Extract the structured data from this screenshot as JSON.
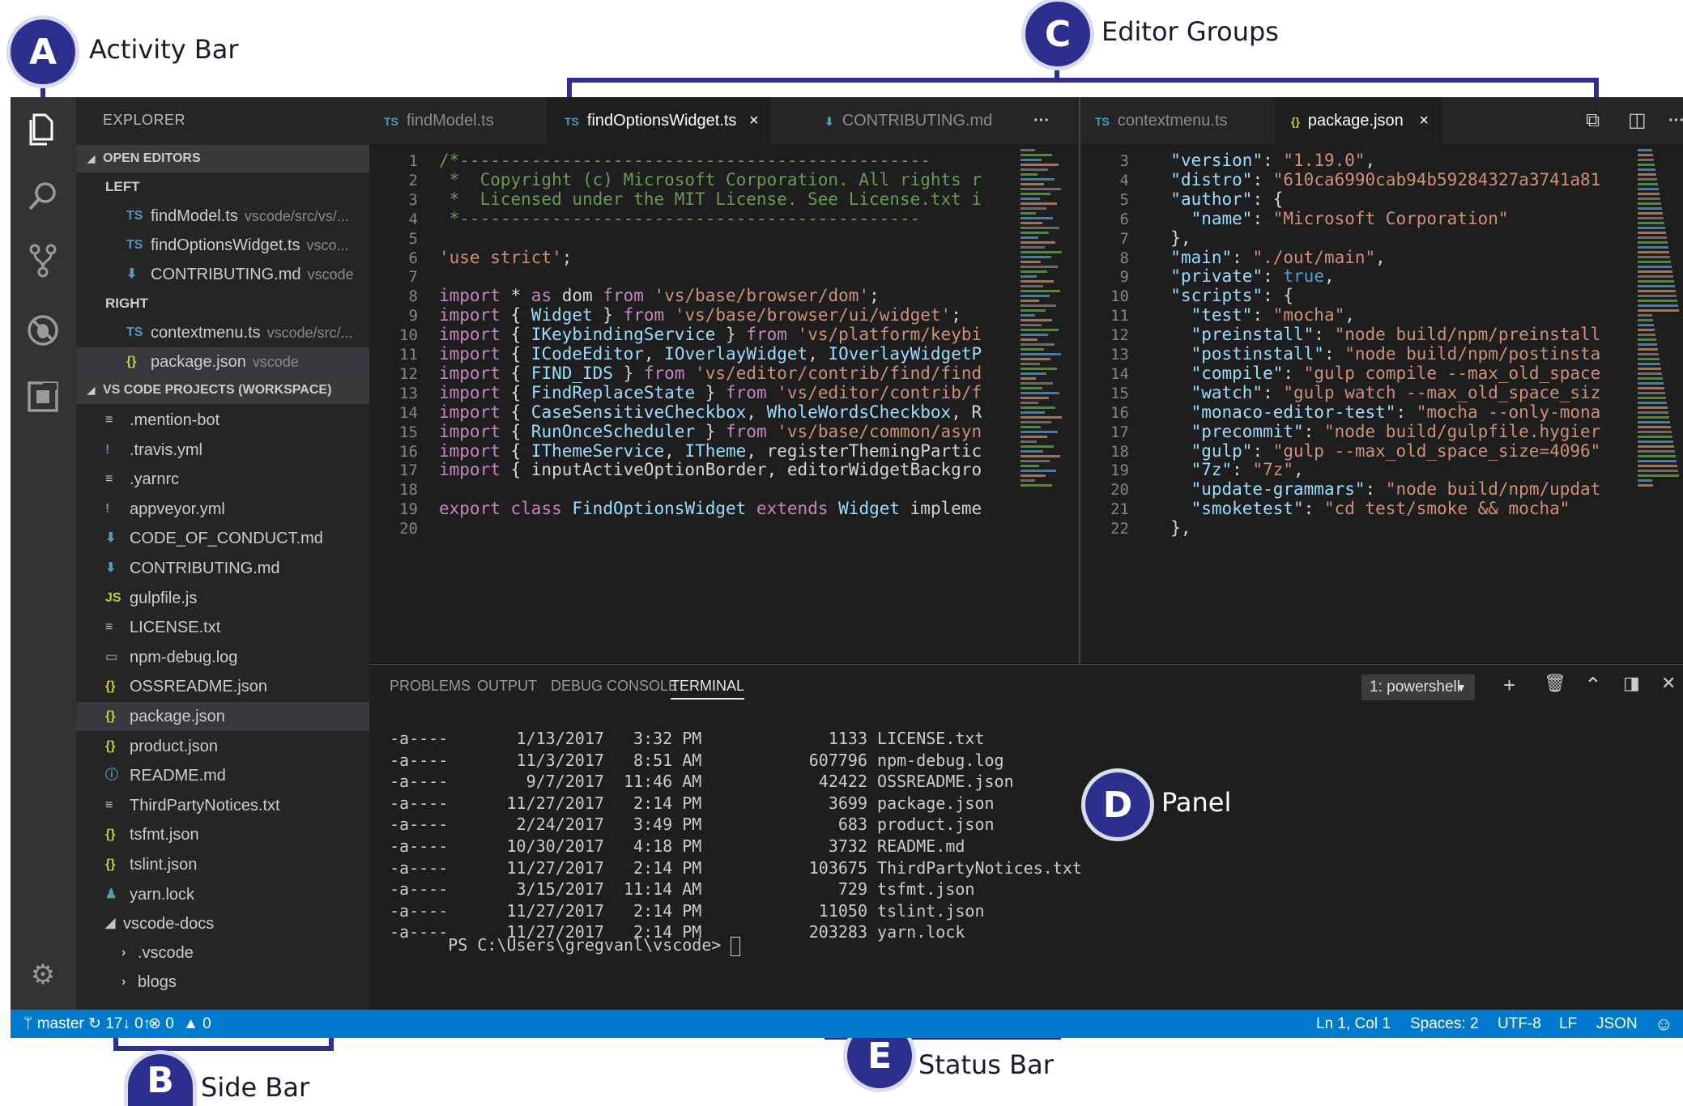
{
  "callouts": [
    {
      "letter": "A",
      "label": "Activity Bar"
    },
    {
      "letter": "B",
      "label": "Side Bar"
    },
    {
      "letter": "C",
      "label": "Editor Groups"
    },
    {
      "letter": "D",
      "label": "Panel"
    },
    {
      "letter": "E",
      "label": "Status Bar"
    }
  ],
  "activity_bar": {
    "icons": [
      "files-icon",
      "search-icon",
      "source-control-icon",
      "debug-icon",
      "extensions-icon"
    ],
    "bottom_icon": "gear-icon"
  },
  "sidebar": {
    "title": "EXPLORER",
    "open_editors_header": "OPEN EDITORS",
    "groups": [
      {
        "label": "LEFT",
        "items": [
          {
            "icon": "TS",
            "name": "findModel.ts",
            "desc": "vscode/src/vs/..."
          },
          {
            "icon": "TS",
            "name": "findOptionsWidget.ts",
            "desc": "vsco..."
          },
          {
            "icon": "⬇",
            "name": "CONTRIBUTING.md",
            "desc": "vscode"
          }
        ]
      },
      {
        "label": "RIGHT",
        "items": [
          {
            "icon": "TS",
            "name": "contextmenu.ts",
            "desc": "vscode/src/..."
          },
          {
            "icon": "{}",
            "name": "package.json",
            "desc": "vscode"
          }
        ]
      }
    ],
    "workspace_header": "VS CODE PROJECTS (WORKSPACE)",
    "files": [
      {
        "icon": "≡",
        "name": ".mention-bot"
      },
      {
        "icon": "!",
        "name": ".travis.yml"
      },
      {
        "icon": "≡",
        "name": ".yarnrc"
      },
      {
        "icon": "!",
        "name": "appveyor.yml"
      },
      {
        "icon": "⬇",
        "name": "CODE_OF_CONDUCT.md"
      },
      {
        "icon": "⬇",
        "name": "CONTRIBUTING.md"
      },
      {
        "icon": "JS",
        "name": "gulpfile.js"
      },
      {
        "icon": "≡",
        "name": "LICENSE.txt"
      },
      {
        "icon": "▭",
        "name": "npm-debug.log"
      },
      {
        "icon": "{}",
        "name": "OSSREADME.json"
      },
      {
        "icon": "{}",
        "name": "package.json"
      },
      {
        "icon": "{}",
        "name": "product.json"
      },
      {
        "icon": "ⓘ",
        "name": "README.md"
      },
      {
        "icon": "≡",
        "name": "ThirdPartyNotices.txt"
      },
      {
        "icon": "{}",
        "name": "tsfmt.json"
      },
      {
        "icon": "{}",
        "name": "tslint.json"
      },
      {
        "icon": "♟",
        "name": "yarn.lock"
      }
    ],
    "folder": "vscode-docs",
    "subfolders": [
      ".vscode",
      "blogs"
    ]
  },
  "editor_left": {
    "tabs": [
      {
        "icon": "TS",
        "name": "findModel.ts"
      },
      {
        "icon": "TS",
        "name": "findOptionsWidget.ts",
        "close": "×"
      },
      {
        "icon": "⬇",
        "name": "CONTRIBUTING.md"
      }
    ],
    "more": "···",
    "line_numbers": [
      "1",
      "2",
      "3",
      "4",
      "5",
      "6",
      "7",
      "8",
      "9",
      "10",
      "11",
      "12",
      "13",
      "14",
      "15",
      "16",
      "17",
      "18",
      "19",
      "20"
    ],
    "lines": [
      "/*----------------------------------------------",
      " *  Copyright (c) Microsoft Corporation. All rights r",
      " *  Licensed under the MIT License. See License.txt i",
      " *---------------------------------------------",
      "",
      "'use strict';",
      "",
      "import * as dom from 'vs/base/browser/dom';",
      "import { Widget } from 'vs/base/browser/ui/widget';",
      "import { IKeybindingService } from 'vs/platform/keybi",
      "import { ICodeEditor, IOverlayWidget, IOverlayWidgetP",
      "import { FIND_IDS } from 'vs/editor/contrib/find/find",
      "import { FindReplaceState } from 'vs/editor/contrib/f",
      "import { CaseSensitiveCheckbox, WholeWordsCheckbox, R",
      "import { RunOnceScheduler } from 'vs/base/common/asyn",
      "import { IThemeService, ITheme, registerThemingPartic",
      "import { inputActiveOptionBorder, editorWidgetBackgro",
      "",
      "export class FindOptionsWidget extends Widget impleme",
      ""
    ]
  },
  "editor_right": {
    "tabs": [
      {
        "icon": "TS",
        "name": "contextmenu.ts"
      },
      {
        "icon": "{}",
        "name": "package.json",
        "close": "×"
      }
    ],
    "more": "···",
    "line_numbers": [
      "3",
      "4",
      "5",
      "6",
      "7",
      "8",
      "9",
      "10",
      "11",
      "12",
      "13",
      "14",
      "15",
      "16",
      "17",
      "18",
      "19",
      "20",
      "21",
      "22"
    ],
    "lines": [
      "  \"version\": \"1.19.0\",",
      "  \"distro\": \"610ca6990cab94b59284327a3741a81",
      "  \"author\": {",
      "    \"name\": \"Microsoft Corporation\"",
      "  },",
      "  \"main\": \"./out/main\",",
      "  \"private\": true,",
      "  \"scripts\": {",
      "    \"test\": \"mocha\",",
      "    \"preinstall\": \"node build/npm/preinstall",
      "    \"postinstall\": \"node build/npm/postinsta",
      "    \"compile\": \"gulp compile --max_old_space",
      "    \"watch\": \"gulp watch --max_old_space_siz",
      "    \"monaco-editor-test\": \"mocha --only-mona",
      "    \"precommit\": \"node build/gulpfile.hygier",
      "    \"gulp\": \"gulp --max_old_space_size=4096\"",
      "    \"7z\": \"7z\",",
      "    \"update-grammars\": \"node build/npm/updat",
      "    \"smoketest\": \"cd test/smoke && mocha\"",
      "  },"
    ]
  },
  "panel": {
    "tabs": [
      "PROBLEMS",
      "OUTPUT",
      "DEBUG CONSOLE",
      "TERMINAL"
    ],
    "active_tab": "TERMINAL",
    "terminal_select": "1: powershell",
    "listing": [
      {
        "mode": "-a----",
        "date": "1/13/2017",
        "time": "3:32 PM",
        "size": "1133",
        "name": "LICENSE.txt"
      },
      {
        "mode": "-a----",
        "date": "11/3/2017",
        "time": "8:51 AM",
        "size": "607796",
        "name": "npm-debug.log"
      },
      {
        "mode": "-a----",
        "date": "9/7/2017",
        "time": "11:46 AM",
        "size": "42422",
        "name": "OSSREADME.json"
      },
      {
        "mode": "-a----",
        "date": "11/27/2017",
        "time": "2:14 PM",
        "size": "3699",
        "name": "package.json"
      },
      {
        "mode": "-a----",
        "date": "2/24/2017",
        "time": "3:49 PM",
        "size": "683",
        "name": "product.json"
      },
      {
        "mode": "-a----",
        "date": "10/30/2017",
        "time": "4:18 PM",
        "size": "3732",
        "name": "README.md"
      },
      {
        "mode": "-a----",
        "date": "11/27/2017",
        "time": "2:14 PM",
        "size": "103675",
        "name": "ThirdPartyNotices.txt"
      },
      {
        "mode": "-a----",
        "date": "3/15/2017",
        "time": "11:14 AM",
        "size": "729",
        "name": "tsfmt.json"
      },
      {
        "mode": "-a----",
        "date": "11/27/2017",
        "time": "2:14 PM",
        "size": "11050",
        "name": "tslint.json"
      },
      {
        "mode": "-a----",
        "date": "11/27/2017",
        "time": "2:14 PM",
        "size": "203283",
        "name": "yarn.lock"
      }
    ],
    "prompt": "PS C:\\Users\\gregvanl\\vscode> "
  },
  "status_bar": {
    "branch": "master",
    "sync": "17↓ 0↑",
    "errors": "0",
    "warnings": "0",
    "position": "Ln 1, Col 1",
    "spaces": "Spaces: 2",
    "encoding": "UTF-8",
    "eol": "LF",
    "language": "JSON"
  },
  "colors": {
    "accent": "#2d2f8f",
    "status_bar": "#007acc",
    "editor_bg": "#1e1e1e",
    "sidebar_bg": "#252526",
    "activity_bg": "#333333"
  }
}
